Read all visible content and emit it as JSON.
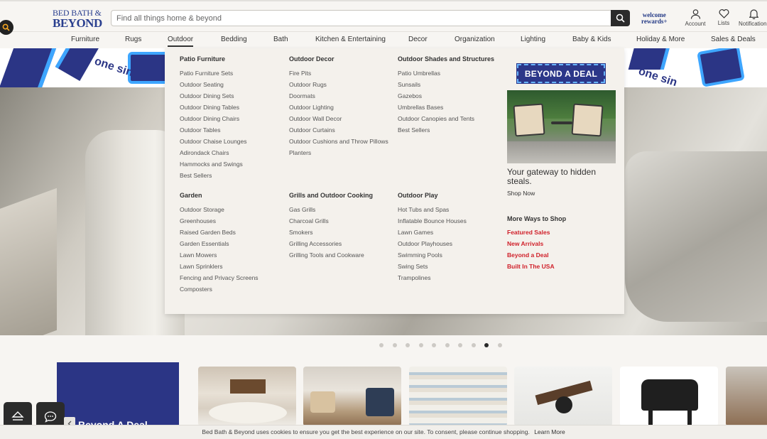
{
  "brand": {
    "line1": "BED BATH &",
    "line2": "BEYOND"
  },
  "search": {
    "placeholder": "Find all things home & beyond"
  },
  "rewards": {
    "line1": "welcome",
    "line2": "rewards+"
  },
  "header_icons": [
    {
      "label": "Account",
      "icon": "account-icon"
    },
    {
      "label": "Lists",
      "icon": "heart-icon"
    },
    {
      "label": "Notifications",
      "icon": "bell-icon"
    }
  ],
  "nav": [
    "Furniture",
    "Rugs",
    "Outdoor",
    "Bedding",
    "Bath",
    "Kitchen & Entertaining",
    "Decor",
    "Organization",
    "Lighting",
    "Baby & Kids",
    "Holiday & More",
    "Sales & Deals"
  ],
  "nav_active": "Outdoor",
  "promo_strip_text": "one sin",
  "menu": {
    "patio_furniture": {
      "title": "Patio Furniture",
      "items": [
        "Patio Furniture Sets",
        "Outdoor Seating",
        "Outdoor Dining Sets",
        "Outdoor Dining Tables",
        "Outdoor Dining Chairs",
        "Outdoor Tables",
        "Outdoor Chaise Lounges",
        "Adirondack Chairs",
        "Hammocks and Swings",
        "Best Sellers"
      ]
    },
    "outdoor_decor": {
      "title": "Outdoor Decor",
      "items": [
        "Fire Pits",
        "Outdoor Rugs",
        "Doormats",
        "Outdoor Lighting",
        "Outdoor Wall Decor",
        "Outdoor Curtains",
        "Outdoor Cushions and Throw Pillows",
        "Planters"
      ]
    },
    "shades": {
      "title": "Outdoor Shades and Structures",
      "items": [
        "Patio Umbrellas",
        "Sunsails",
        "Gazebos",
        "Umbrellas Bases",
        "Outdoor Canopies and Tents",
        "Best Sellers"
      ]
    },
    "garden": {
      "title": "Garden",
      "items": [
        "Outdoor Storage",
        "Greenhouses",
        "Raised Garden Beds",
        "Garden Essentials",
        "Lawn Mowers",
        "Lawn Sprinklers",
        "Fencing and Privacy Screens",
        "Composters"
      ]
    },
    "grills": {
      "title": "Grills and Outdoor Cooking",
      "items": [
        "Gas Grills",
        "Charcoal Grills",
        "Smokers",
        "Grilling Accessories",
        "Grilling Tools and Cookware"
      ]
    },
    "play": {
      "title": "Outdoor Play",
      "items": [
        "Hot Tubs and Spas",
        "Inflatable Bounce Houses",
        "Lawn Games",
        "Outdoor Playhouses",
        "Swimming Pools",
        "Swing Sets",
        "Trampolines"
      ]
    },
    "promo": {
      "badge": "BEYOND A DEAL",
      "title": "Your gateway to hidden steals.",
      "link": "Shop Now"
    },
    "more": {
      "title": "More Ways to Shop",
      "items": [
        "Featured Sales",
        "New Arrivals",
        "Beyond a Deal",
        "Built In The USA"
      ]
    }
  },
  "carousel": {
    "dot_count": 10,
    "active_index": 8
  },
  "tiles": {
    "first_text": "Beyond A Deal"
  },
  "cookie": {
    "text": "Bed Bath & Beyond uses cookies to ensure you get the best experience on our site. To consent, please continue shopping.",
    "link": "Learn More"
  },
  "colors": {
    "brand_navy": "#2b3585",
    "accent_red": "#d0202a",
    "menu_bg": "#f4f1ec"
  }
}
